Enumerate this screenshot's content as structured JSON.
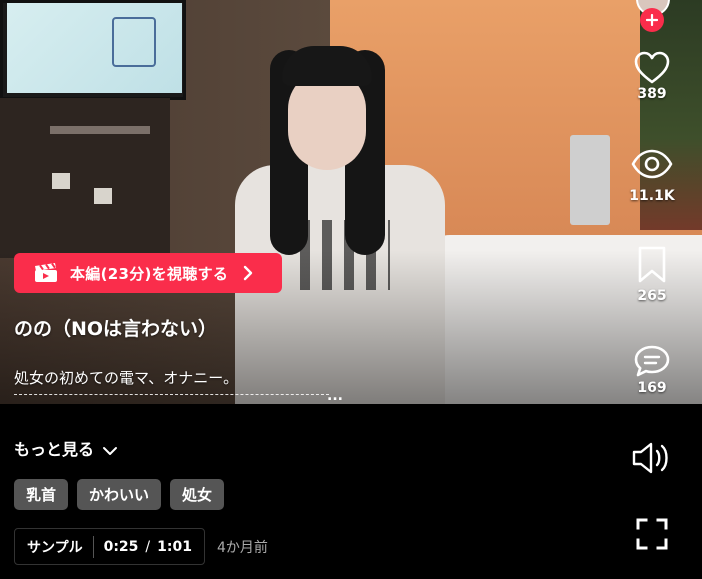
{
  "video": {
    "watch_button_label": "本編(23分)を視聴する",
    "title": "のの（NOは言わない）",
    "description": "処女の初めての電マ、オナニー。",
    "description_ellipsis": "..."
  },
  "actions": {
    "likes": "389",
    "views": "11.1K",
    "saves": "265",
    "comments": "169"
  },
  "details": {
    "show_more_label": "もっと見る",
    "tags": [
      "乳首",
      "かわいい",
      "処女"
    ],
    "sample_label": "サンプル",
    "time_current": "0:25",
    "time_separator": "/",
    "time_total": "1:01",
    "posted_ago": "4か月前"
  },
  "colors": {
    "accent": "#fa2d4b",
    "tag_bg": "#555555",
    "background": "#000000"
  },
  "icons": {
    "like": "heart-icon",
    "views": "eye-icon",
    "save": "bookmark-icon",
    "comment": "comment-icon",
    "sound": "speaker-icon",
    "fullscreen": "fullscreen-icon",
    "follow": "plus-icon"
  }
}
